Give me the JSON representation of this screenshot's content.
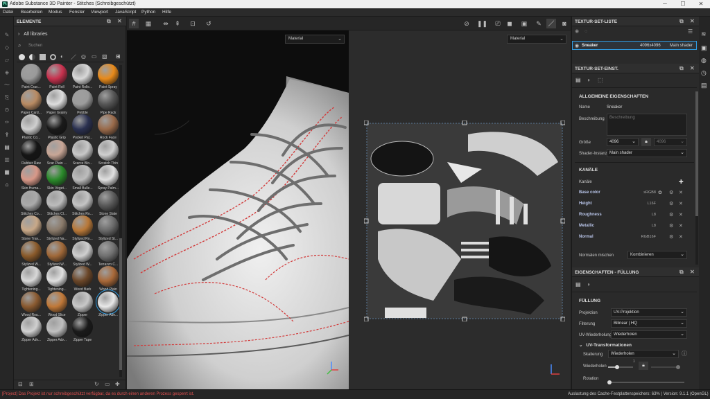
{
  "window": {
    "title": "Adobe Substance 3D Painter - Stitches (Schreibgeschützt)",
    "icon": "Pt",
    "minimize": "─",
    "maximize": "☐",
    "close": "✕"
  },
  "menu": [
    "Datei",
    "Bearbeiten",
    "Modus",
    "Fenster",
    "Viewport",
    "JavaScript",
    "Python",
    "Hilfe"
  ],
  "shelf": {
    "title": "ELEMENTE",
    "library": "All libraries",
    "search_placeholder": "Suchen",
    "items": [
      {
        "label": "Paint Crac...",
        "color": "#9a9a9a"
      },
      {
        "label": "Paint Roll",
        "color": "#c8314e"
      },
      {
        "label": "Paint Rolle...",
        "color": "#d8d8d8"
      },
      {
        "label": "Paint Spray",
        "color": "#e88a1a"
      },
      {
        "label": "Paper Card...",
        "color": "#b88a62"
      },
      {
        "label": "Paper Grainy",
        "color": "#dedede"
      },
      {
        "label": "Pebble",
        "color": "#9c9c9c"
      },
      {
        "label": "Pipe Rack",
        "color": "#555555"
      },
      {
        "label": "Plastic Co...",
        "color": "#cfcfcf"
      },
      {
        "label": "Plastic Grip",
        "color": "#1a1a1a"
      },
      {
        "label": "Pocket Pat...",
        "color": "#2a3050"
      },
      {
        "label": "Rock Face",
        "color": "#9a6a4a"
      },
      {
        "label": "Rubber Raw",
        "color": "#151515"
      },
      {
        "label": "Scar Plain ...",
        "color": "#c8a696"
      },
      {
        "label": "Scarce Blo...",
        "color": "#c8c8c8"
      },
      {
        "label": "Scratch Thin",
        "color": "#d0d0d0"
      },
      {
        "label": "Skin Huma...",
        "color": "#d89888"
      },
      {
        "label": "Skin Veget...",
        "color": "#2a8a2a"
      },
      {
        "label": "Small Bulle...",
        "color": "#bdbdbd"
      },
      {
        "label": "Spray Palm...",
        "color": "#e0e0e0"
      },
      {
        "label": "Stitches Co...",
        "color": "#aaaaaa"
      },
      {
        "label": "Stitches Cl...",
        "color": "#bcbcbc"
      },
      {
        "label": "Stitches Ro...",
        "color": "#c4c4c4"
      },
      {
        "label": "Stone Slate",
        "color": "#5a5a5a"
      },
      {
        "label": "Stone Trav...",
        "color": "#c8a888"
      },
      {
        "label": "Stylized Na...",
        "color": "#8a7a6a"
      },
      {
        "label": "Stylized Ro...",
        "color": "#b87838"
      },
      {
        "label": "Stylized St...",
        "color": "#6a6a6a"
      },
      {
        "label": "Stylized W...",
        "color": "#8a5a2a"
      },
      {
        "label": "Stylized W...",
        "color": "#a06838"
      },
      {
        "label": "Stylized W...",
        "color": "#cfcfcf"
      },
      {
        "label": "Terrazzo C...",
        "color": "#707070"
      },
      {
        "label": "Tightening...",
        "color": "#d8d8d8"
      },
      {
        "label": "Tightening...",
        "color": "#e0e0e0"
      },
      {
        "label": "Wood Bark",
        "color": "#6a4628"
      },
      {
        "label": "Wood Plain",
        "color": "#a86838"
      },
      {
        "label": "Wood Rou...",
        "color": "#8a5a30"
      },
      {
        "label": "Wood Slice",
        "color": "#c07838"
      },
      {
        "label": "Zipper",
        "color": "#c8c8c8"
      },
      {
        "label": "Zipper Adv...",
        "color": "#e8e8e8"
      },
      {
        "label": "Zipper Adv...",
        "color": "#d0d0d0"
      },
      {
        "label": "Zipper Adv...",
        "color": "#c0c0c0"
      },
      {
        "label": "Zipper Tape",
        "color": "#1a1a1a"
      }
    ]
  },
  "viewport": {
    "left_mode": "Material",
    "right_mode": "Material"
  },
  "texture_set_list": {
    "title": "TEXTUR-SET-LISTE",
    "name": "Sneaker",
    "resolution": "4096x4096",
    "shader": "Main shader"
  },
  "texture_set_settings": {
    "title": "TEXTUR-SET-EINST.",
    "general_title": "ALLGEMEINE EIGENSCHAFTEN",
    "name_label": "Name",
    "name_value": "Sneaker",
    "desc_label": "Beschreibung",
    "desc_placeholder": "Beschreibung",
    "size_label": "Größe",
    "size_value": "4096",
    "size_value2": "4096",
    "shader_label": "Shader-Instanz",
    "shader_value": "Main shader",
    "channels_title": "KANÄLE",
    "channels_label": "Kanäle",
    "channels": [
      {
        "name": "Base color",
        "format": "sRGB8"
      },
      {
        "name": "Height",
        "format": "L16F"
      },
      {
        "name": "Roughness",
        "format": "L8"
      },
      {
        "name": "Metallic",
        "format": "L8"
      },
      {
        "name": "Normal",
        "format": "RGB16F"
      }
    ],
    "normal_mix_label": "Normalen mischen",
    "normal_mix_value": "Kombinieren"
  },
  "fill_properties": {
    "title": "EIGENSCHAFTEN - FÜLLUNG",
    "section": "FÜLLUNG",
    "projection_label": "Projektion",
    "projection_value": "UV-Projektion",
    "filtering_label": "Filterung",
    "filtering_value": "Bilinear | HQ",
    "uv_wrap_label": "UV-Wiederholung",
    "uv_wrap_value": "Wiederholen",
    "uv_transform_title": "UV-Transformationen",
    "scaling_label": "Skalierung",
    "scaling_value": "Wiederholen",
    "repeat_label": "Wiederholen",
    "repeat_value": "1",
    "repeat_fraction": 0.35,
    "rotation_label": "Rotation",
    "rotation_fraction": 0.0
  },
  "status": {
    "left": "[Project] Das Projekt ist nur schreibgeschützt verfügbar, da es durch einen anderen Prozess gesperrt ist.",
    "right": "Auslastung des Cache-Festplattenspeichers:  63%  |  Version: 9.1.1 (OpenGL)"
  },
  "colors": {
    "accent": "#2f9be0",
    "stitch": "#d23a3a",
    "error": "#e05050"
  }
}
